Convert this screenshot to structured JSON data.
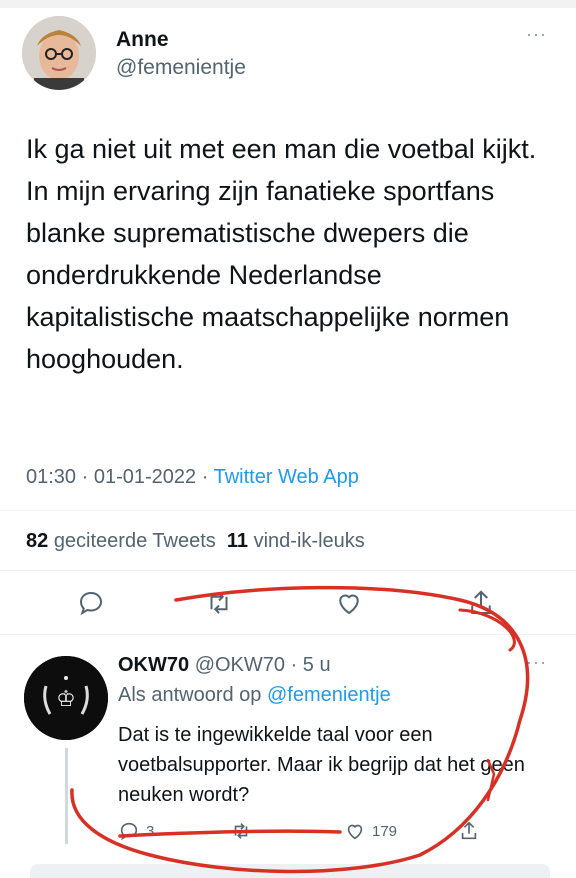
{
  "tweet": {
    "author_name": "Anne",
    "author_handle": "@femenientje",
    "more_icon": "···",
    "text": "Ik ga niet uit met een man die voetbal kijkt. In mijn ervaring zijn fanatieke sportfans blanke suprematistische dwepers die onderdrukkende Nederlandse kapitalistische maatschappelijke normen hooghouden.",
    "time": "01:30",
    "date": "01-01-2022",
    "separator": " · ",
    "app": "Twitter Web App",
    "retweets_count": "82",
    "retweets_label": "geciteerde Tweets",
    "likes_count": "11",
    "likes_label": "vind-ik-leuks"
  },
  "reply": {
    "author_name": "OKW70",
    "author_handle": "@OKW70",
    "time": "5 u",
    "more_icon": "···",
    "replying_to_label": "Als antwoord op",
    "replying_to_handle": "@femenientje",
    "text": "Dat is te ingewikkelde taal voor een voetbalsupporter. Maar ik begrijp dat het geen neuken wordt?",
    "reply_count": "3",
    "retweet_count": "",
    "like_count": "179"
  },
  "colors": {
    "text": "#0f1419",
    "secondary": "#536471",
    "link": "#1d9bf0",
    "annotation": "#d93025"
  },
  "icons": [
    "reply-icon",
    "retweet-icon",
    "like-icon",
    "share-icon",
    "more-icon"
  ]
}
